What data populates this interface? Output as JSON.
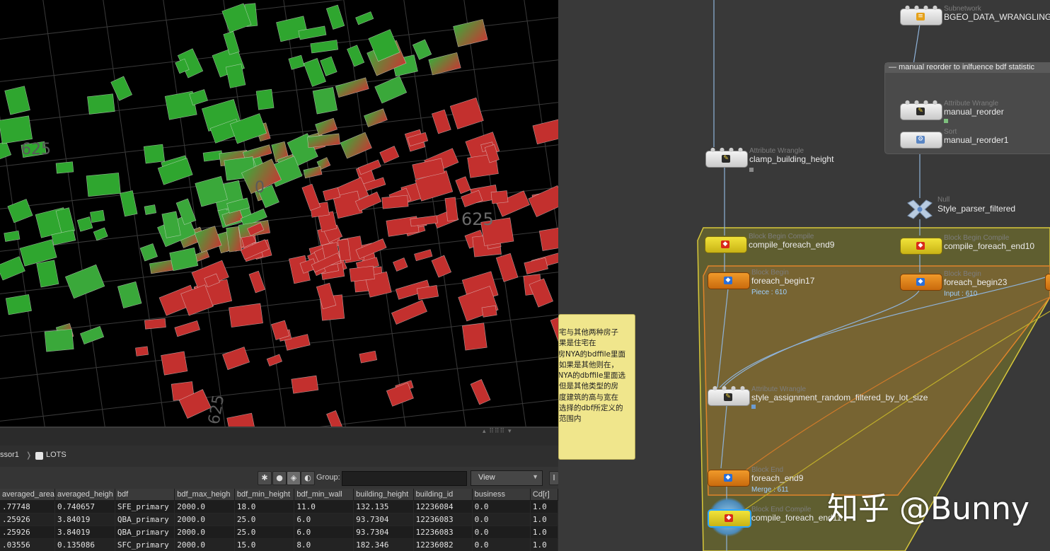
{
  "viewport": {
    "grid_labels": [
      "625",
      "625",
      "0",
      "625"
    ]
  },
  "pathbar": {
    "crumbs": [
      "ssor1",
      "LOTS"
    ]
  },
  "spreadsheet_toolbar": {
    "group_label": "Group:",
    "group_value": "",
    "view_label": "View",
    "extra_button_label": "I"
  },
  "spreadsheet": {
    "columns": [
      "averaged_area",
      "averaged_heigh",
      "bdf",
      "bdf_max_heigh",
      "bdf_min_height",
      "bdf_min_wall",
      "building_height",
      "building_id",
      "business",
      "Cd[r]"
    ],
    "rows": [
      [
        ".77748",
        "0.740657",
        "SFE_primary",
        "2000.0",
        "18.0",
        "11.0",
        "132.135",
        "12236084",
        "0.0",
        "1.0"
      ],
      [
        ".25926",
        "3.84019",
        "QBA_primary",
        "2000.0",
        "25.0",
        "6.0",
        "93.7304",
        "12236083",
        "0.0",
        "1.0"
      ],
      [
        ".25926",
        "3.84019",
        "QBA_primary",
        "2000.0",
        "25.0",
        "6.0",
        "93.7304",
        "12236083",
        "0.0",
        "1.0"
      ],
      [
        ".03556",
        "0.135086",
        "SFC_primary",
        "2000.0",
        "15.0",
        "8.0",
        "182.346",
        "12236082",
        "0.0",
        "1.0"
      ]
    ]
  },
  "network": {
    "netbox_title": "manual reorder to inlfuence bdf statistic",
    "sticky_note": "宅与其他两种房子\n果是住宅在\n房NYA的bdffile里面\n，如果是其他则在\nNYA的dbffile里面选\n但是其他类型的房\n度建筑的高与宽在\n选择的dbf所定义的\n范围内",
    "nodes": [
      {
        "type": "Subnetwork",
        "name": "BGEO_DATA_WRANGLING",
        "info": ""
      },
      {
        "type": "Attribute Wrangle",
        "name": "manual_reorder",
        "info": ""
      },
      {
        "type": "Sort",
        "name": "manual_reorder1",
        "info": ""
      },
      {
        "type": "Attribute Wrangle",
        "name": "clamp_building_height",
        "info": ""
      },
      {
        "type": "Null",
        "name": "Style_parser_filtered",
        "info": ""
      },
      {
        "type": "Block Begin Compile",
        "name": "compile_foreach_end9",
        "info": ""
      },
      {
        "type": "Block Begin Compile",
        "name": "compile_foreach_end10",
        "info": ""
      },
      {
        "type": "Block Begin",
        "name": "foreach_begin17",
        "info": "Piece : 610"
      },
      {
        "type": "Block Begin",
        "name": "foreach_begin23",
        "info": "Input : 610"
      },
      {
        "type": "Attribute Wrangle",
        "name": "style_assignment_random_filtered_by_lot_size",
        "info": ""
      },
      {
        "type": "Block End",
        "name": "foreach_end9",
        "info": "Merge : 611"
      },
      {
        "type": "Block End Compile",
        "name": "compile_foreach_end11",
        "info": ""
      }
    ]
  },
  "watermark": "知乎 @Bunny",
  "colors": {
    "viewport_bg": "#000000",
    "network_bg": "#393939",
    "block_compile_fill": "#8a8a2a",
    "foreach_fill": "#9a7a3a",
    "sticky_bg": "#f0e68c"
  }
}
